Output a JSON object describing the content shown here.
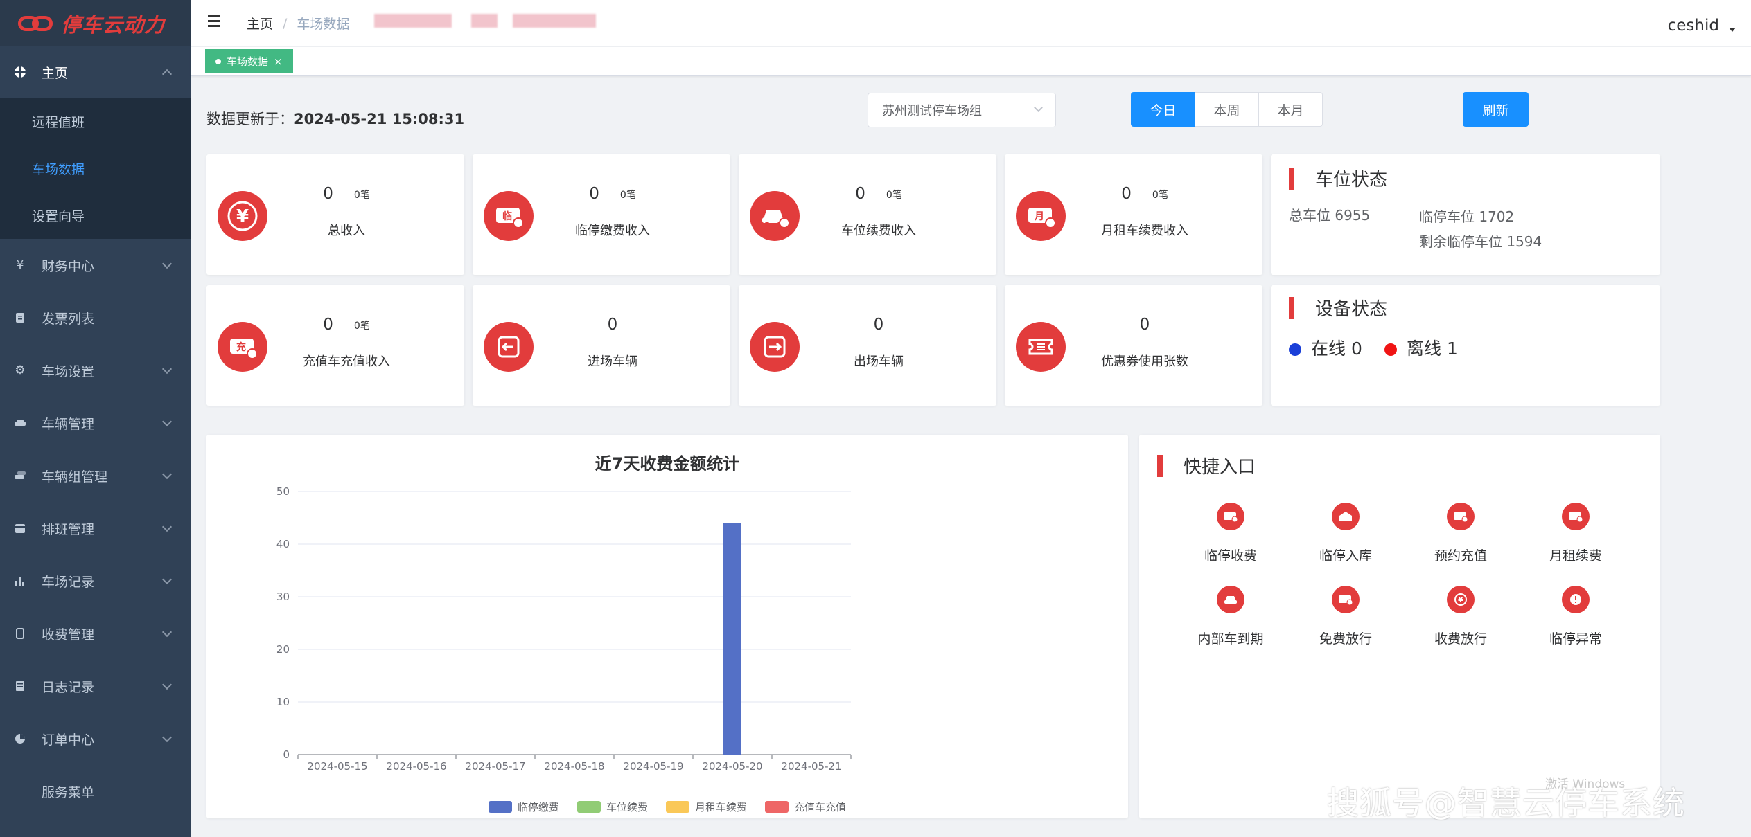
{
  "app": {
    "logo_text": "停车云动力"
  },
  "sidebar": {
    "home_label": "主页",
    "home_sub": [
      {
        "label": "远程值班"
      },
      {
        "label": "车场数据"
      },
      {
        "label": "设置向导"
      }
    ],
    "items": [
      {
        "label": "财务中心",
        "icon": "yen-icon"
      },
      {
        "label": "发票列表",
        "icon": "document-icon"
      },
      {
        "label": "车场设置",
        "icon": "gear-icon"
      },
      {
        "label": "车辆管理",
        "icon": "car-icon"
      },
      {
        "label": "车辆组管理",
        "icon": "car-group-icon"
      },
      {
        "label": "排班管理",
        "icon": "calendar-icon"
      },
      {
        "label": "车场记录",
        "icon": "bar-chart-icon"
      },
      {
        "label": "收费管理",
        "icon": "phone-icon"
      },
      {
        "label": "日志记录",
        "icon": "log-icon"
      },
      {
        "label": "订单中心",
        "icon": "pie-icon"
      },
      {
        "label": "服务菜单",
        "icon": ""
      }
    ]
  },
  "header": {
    "breadcrumb": [
      "主页",
      "车场数据"
    ],
    "user": "ceshid"
  },
  "tags": {
    "active": "车场数据",
    "close": "×"
  },
  "toolbar": {
    "update_label": "数据更新于：",
    "update_time": "2024-05-21 15:08:31",
    "group_select": "苏州测试停车场组",
    "periods": [
      "今日",
      "本周",
      "本月"
    ],
    "active_period": "今日",
    "refresh": "刷新"
  },
  "stats": [
    {
      "value": "0",
      "count": "0笔",
      "label": "总收入",
      "icon": "yen-icon"
    },
    {
      "value": "0",
      "count": "0笔",
      "label": "临停缴费收入",
      "icon": "temp-ticket-icon"
    },
    {
      "value": "0",
      "count": "0笔",
      "label": "车位续费收入",
      "icon": "car-icon"
    },
    {
      "value": "0",
      "count": "0笔",
      "label": "月租车续费收入",
      "icon": "monthly-ticket-icon"
    },
    {
      "value": "0",
      "count": "0笔",
      "label": "充值车充值收入",
      "icon": "recharge-ticket-icon"
    },
    {
      "value": "0",
      "count": "",
      "label": "进场车辆",
      "icon": "enter-icon"
    },
    {
      "value": "0",
      "count": "",
      "label": "出场车辆",
      "icon": "exit-icon"
    },
    {
      "value": "0",
      "count": "",
      "label": "优惠券使用张数",
      "icon": "coupon-icon"
    }
  ],
  "space_status": {
    "title": "车位状态",
    "total": "总车位 6955",
    "temp": "临停车位 1702",
    "remaining": "剩余临停车位 1594"
  },
  "device_status": {
    "title": "设备状态",
    "online": "在线 0",
    "offline": "离线 1",
    "online_color": "#1a3fd8",
    "offline_color": "#f01414"
  },
  "chart_data": {
    "type": "bar",
    "title": "近7天收费金额统计",
    "categories": [
      "2024-05-15",
      "2024-05-16",
      "2024-05-17",
      "2024-05-18",
      "2024-05-19",
      "2024-05-20",
      "2024-05-21"
    ],
    "ylim": [
      0,
      50
    ],
    "yticks": [
      0,
      10,
      20,
      30,
      40,
      50
    ],
    "grid": true,
    "legend_position": "bottom",
    "series": [
      {
        "name": "临停缴费",
        "color": "#5470c6",
        "values": [
          0,
          0,
          0,
          0,
          0,
          44,
          0
        ]
      },
      {
        "name": "车位续费",
        "color": "#91cc75",
        "values": [
          0,
          0,
          0,
          0,
          0,
          0,
          0
        ]
      },
      {
        "name": "月租车续费",
        "color": "#fac858",
        "values": [
          0,
          0,
          0,
          0,
          0,
          0,
          0
        ]
      },
      {
        "name": "充值车充值",
        "color": "#ee6666",
        "values": [
          0,
          0,
          0,
          0,
          0,
          0,
          0
        ]
      }
    ]
  },
  "quick_entry": {
    "title": "快捷入口",
    "items": [
      {
        "label": "临停收费",
        "icon": "temp-fee-icon"
      },
      {
        "label": "临停入库",
        "icon": "garage-icon"
      },
      {
        "label": "预约充值",
        "icon": "recharge-icon"
      },
      {
        "label": "月租续费",
        "icon": "monthly-icon"
      },
      {
        "label": "内部车到期",
        "icon": "car-expire-icon"
      },
      {
        "label": "免费放行",
        "icon": "free-release-icon"
      },
      {
        "label": "收费放行",
        "icon": "paid-release-icon"
      },
      {
        "label": "临停异常",
        "icon": "alert-icon"
      }
    ]
  },
  "watermark": "搜狐号@智慧云停车系统",
  "os_overlay": "激活 Windows"
}
